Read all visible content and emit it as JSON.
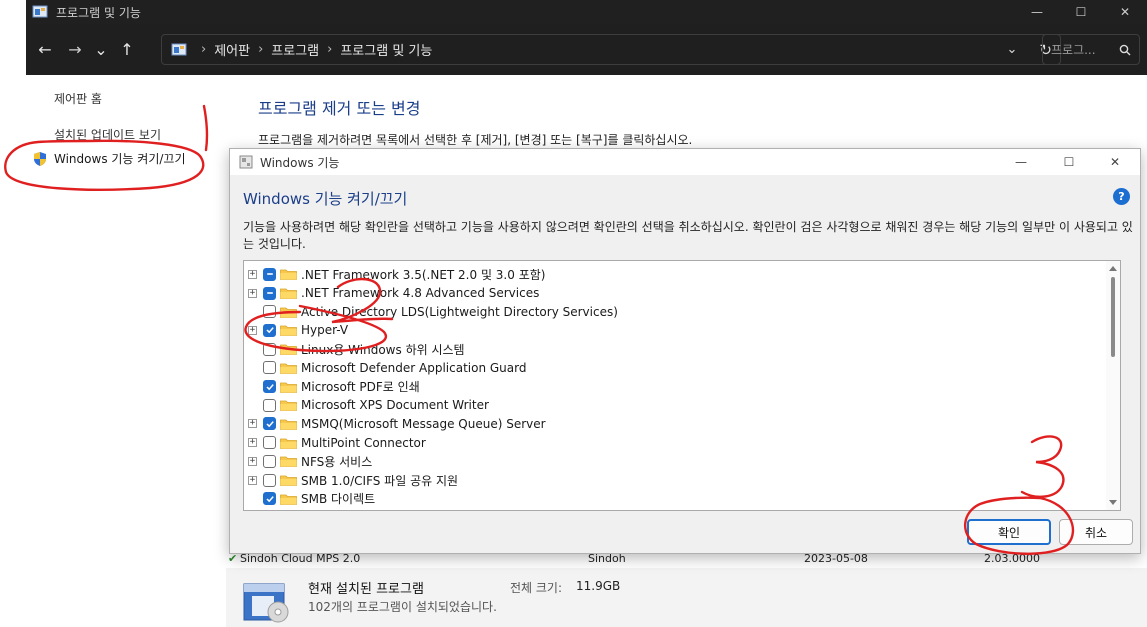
{
  "window": {
    "title": "프로그램 및 기능",
    "minimize": "—",
    "maximize": "☐",
    "close": "✕"
  },
  "nav": {
    "back": "←",
    "forward": "→",
    "recent": "⌄",
    "up": "↑",
    "breadcrumbs": [
      "제어판",
      "프로그램",
      "프로그램 및 기능"
    ],
    "search_placeholder": "프로그...",
    "refresh": "↻",
    "dropdown": "⌄"
  },
  "sidebar": {
    "home": "제어판 홈",
    "installed_updates": "설치된 업데이트 보기",
    "windows_features": "Windows 기능 켜기/끄기"
  },
  "main": {
    "title": "프로그램 제거 또는 변경",
    "description": "프로그램을 제거하려면 목록에서 선택한 후 [제거], [변경] 또는 [복구]를 클릭하십시오."
  },
  "bg_row": {
    "name": "Sindoh Cloud MPS 2.0",
    "publisher": "Sindoh",
    "date": "2023-05-08",
    "version": "2.03.0000"
  },
  "summary": {
    "title": "현재 설치된 프로그램",
    "size_label": "전체 크기:",
    "size_value": "11.9GB",
    "count_text": "102개의 프로그램이 설치되었습니다."
  },
  "dialog": {
    "title": "Windows 기능",
    "heading": "Windows 기능 켜기/끄기",
    "help": "?",
    "description": "기능을 사용하려면 해당 확인란을 선택하고 기능을 사용하지 않으려면 확인란의 선택을 취소하십시오. 확인란이 검은 사각형으로 채워진 경우는 해당 기능의 일부만 이 사용되고 있는 것입니다.",
    "ok": "확인",
    "cancel": "취소",
    "features": [
      {
        "label": ".NET Framework 3.5(.NET 2.0 및 3.0 포함)",
        "state": "partial",
        "expandable": true
      },
      {
        "label": ".NET Framework 4.8 Advanced Services",
        "state": "partial",
        "expandable": true
      },
      {
        "label": "Active Directory LDS(Lightweight Directory Services)",
        "state": "unchecked",
        "expandable": false
      },
      {
        "label": "Hyper-V",
        "state": "checked",
        "expandable": true
      },
      {
        "label": "Linux용 Windows 하위 시스템",
        "state": "unchecked",
        "expandable": false
      },
      {
        "label": "Microsoft Defender Application Guard",
        "state": "unchecked",
        "expandable": false
      },
      {
        "label": "Microsoft PDF로 인쇄",
        "state": "checked",
        "expandable": false
      },
      {
        "label": "Microsoft XPS Document Writer",
        "state": "unchecked",
        "expandable": false
      },
      {
        "label": "MSMQ(Microsoft Message Queue) Server",
        "state": "checked",
        "expandable": true
      },
      {
        "label": "MultiPoint Connector",
        "state": "unchecked",
        "expandable": true
      },
      {
        "label": "NFS용 서비스",
        "state": "unchecked",
        "expandable": true
      },
      {
        "label": "SMB 1.0/CIFS 파일 공유 지원",
        "state": "unchecked",
        "expandable": true
      },
      {
        "label": "SMB 다이렉트",
        "state": "checked",
        "expandable": false
      }
    ]
  },
  "annotations": {
    "one": "1",
    "two": "2",
    "three": "3",
    "color": "#e02020"
  }
}
